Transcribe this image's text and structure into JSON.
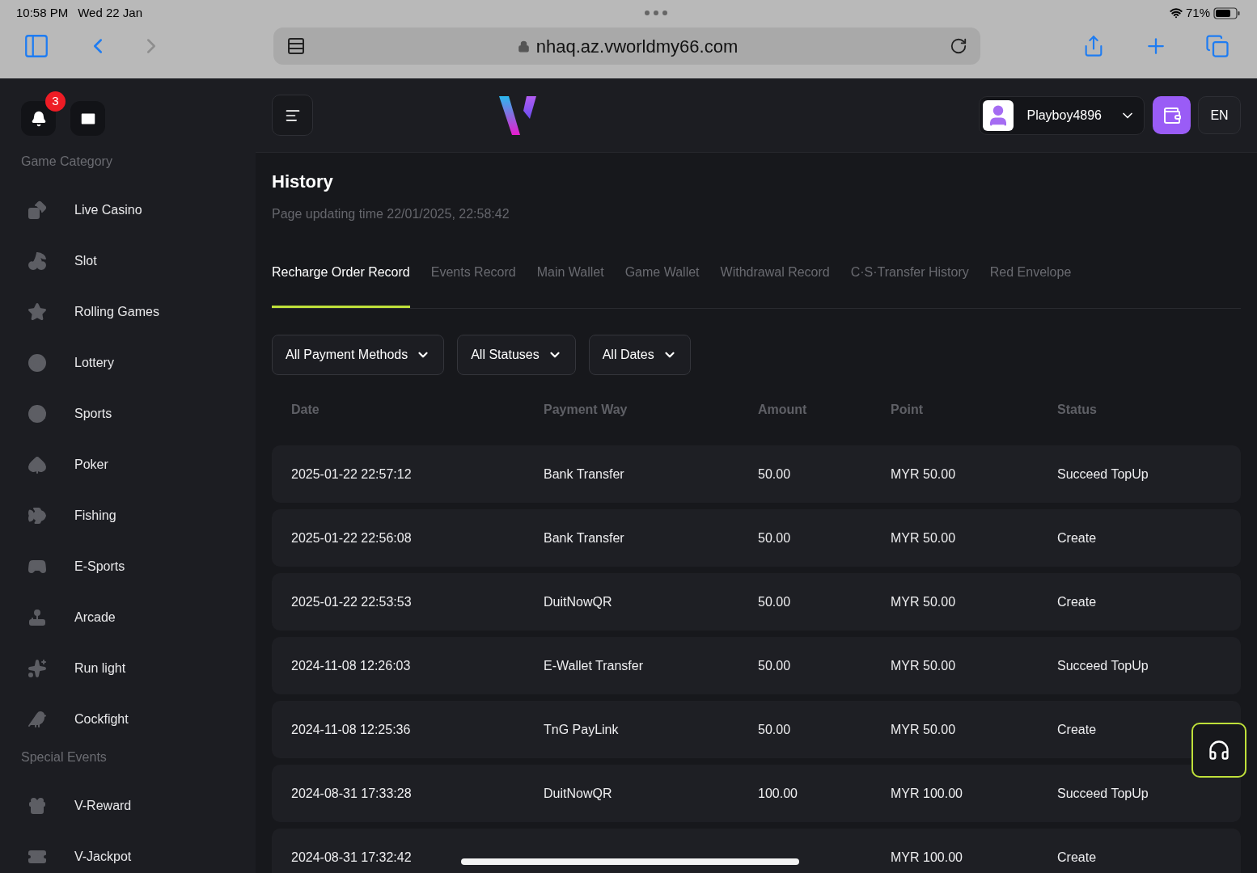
{
  "status_bar": {
    "time": "10:58 PM",
    "date": "Wed 22 Jan",
    "battery": "71%"
  },
  "browser": {
    "url": "nhaq.az.vworldmy66.com"
  },
  "sidebar": {
    "notification_count": "3",
    "sections": [
      {
        "title": "Game Category",
        "items": [
          {
            "label": "Live Casino"
          },
          {
            "label": "Slot"
          },
          {
            "label": "Rolling Games"
          },
          {
            "label": "Lottery"
          },
          {
            "label": "Sports"
          },
          {
            "label": "Poker"
          },
          {
            "label": "Fishing"
          },
          {
            "label": "E-Sports"
          },
          {
            "label": "Arcade"
          },
          {
            "label": "Run light"
          },
          {
            "label": "Cockfight"
          }
        ]
      },
      {
        "title": "Special Events",
        "items": [
          {
            "label": "V-Reward"
          },
          {
            "label": "V-Jackpot"
          }
        ]
      }
    ]
  },
  "header": {
    "username": "Playboy4896",
    "language": "EN"
  },
  "page": {
    "title": "History",
    "updated": "Page updating time 22/01/2025, 22:58:42"
  },
  "tabs": [
    {
      "label": "Recharge Order Record",
      "selected": true
    },
    {
      "label": "Events Record",
      "selected": false
    },
    {
      "label": "Main Wallet",
      "selected": false
    },
    {
      "label": "Game Wallet",
      "selected": false
    },
    {
      "label": "Withdrawal Record",
      "selected": false
    },
    {
      "label": "C·S·Transfer History",
      "selected": false
    },
    {
      "label": "Red Envelope",
      "selected": false
    }
  ],
  "filters": [
    "All Payment Methods",
    "All Statuses",
    "All Dates"
  ],
  "table": {
    "columns": [
      "Date",
      "Payment Way",
      "Amount",
      "Point",
      "Status"
    ],
    "rows": [
      {
        "date": "2025-01-22 22:57:12",
        "payment_way": "Bank Transfer",
        "amount": "50.00",
        "point": "MYR 50.00",
        "status": "Succeed TopUp"
      },
      {
        "date": "2025-01-22 22:56:08",
        "payment_way": "Bank Transfer",
        "amount": "50.00",
        "point": "MYR 50.00",
        "status": "Create"
      },
      {
        "date": "2025-01-22 22:53:53",
        "payment_way": "DuitNowQR",
        "amount": "50.00",
        "point": "MYR 50.00",
        "status": "Create"
      },
      {
        "date": "2024-11-08 12:26:03",
        "payment_way": "E-Wallet Transfer",
        "amount": "50.00",
        "point": "MYR 50.00",
        "status": "Succeed TopUp"
      },
      {
        "date": "2024-11-08 12:25:36",
        "payment_way": "TnG PayLink",
        "amount": "50.00",
        "point": "MYR 50.00",
        "status": "Create"
      },
      {
        "date": "2024-08-31 17:33:28",
        "payment_way": "DuitNowQR",
        "amount": "100.00",
        "point": "MYR 100.00",
        "status": "Succeed TopUp"
      },
      {
        "date": "2024-08-31 17:32:42",
        "point": "MYR 100.00",
        "status": "Create"
      }
    ]
  }
}
